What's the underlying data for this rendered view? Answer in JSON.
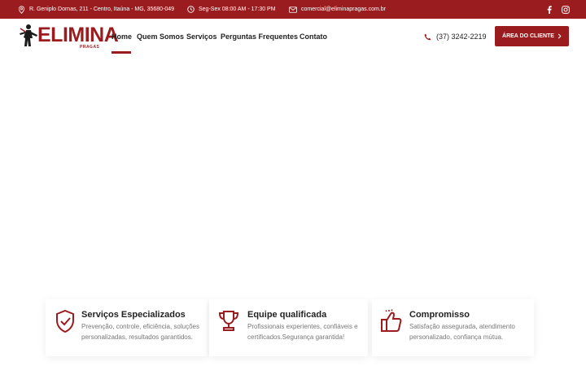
{
  "topbar": {
    "address": "R. Geniplo Dornas, 211 - Centro, Itaúna - MG, 35680-049",
    "hours": "Seg-Sex 08:00 AM - 17:30 PM",
    "email": "comercial@eliminapragas.com.br"
  },
  "logo": {
    "name": "ELIMINA",
    "sub": "PRAGAS"
  },
  "nav": {
    "items": [
      {
        "label": "Home"
      },
      {
        "label": "Quem Somos"
      },
      {
        "label": "Serviços"
      },
      {
        "label": "Perguntas Frequentes"
      },
      {
        "label": "Contato"
      }
    ],
    "active": "Home"
  },
  "phone": "(37) 3242-2219",
  "cta": {
    "label": "ÁREA DO CLIENTE"
  },
  "features": [
    {
      "icon": "shield-check-icon",
      "title": "Serviços Especializados",
      "lines": [
        "Prevenção, controle, eficiência, soluções",
        "personalizadas, resultados garantidos."
      ]
    },
    {
      "icon": "trophy-icon",
      "title": "Equipe qualificada",
      "lines": [
        "Profissionais experientes, confiáveis e",
        "certificados.Segurança garantida!"
      ]
    },
    {
      "icon": "thumbs-up-icon",
      "title": "Compromisso",
      "lines": [
        "Satisfação assegurada, atendimento",
        "personalizado, confiança mútua."
      ]
    }
  ],
  "colors": {
    "brand": "#9b1c1f",
    "text": "#222222",
    "muted": "#777777"
  }
}
